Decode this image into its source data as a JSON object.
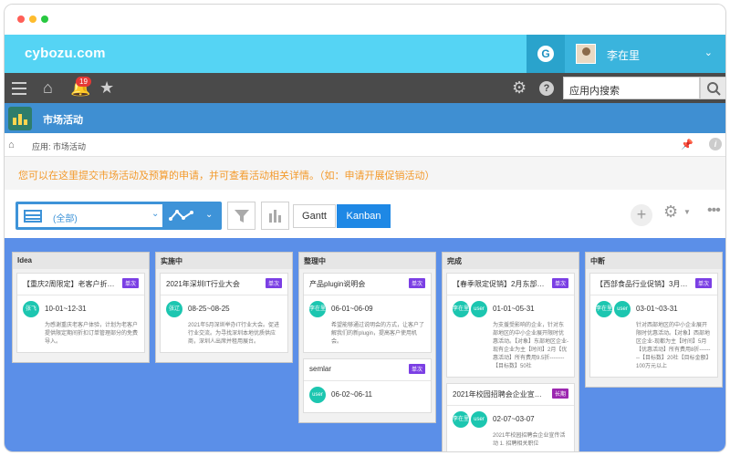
{
  "brand": "cybozu.com",
  "user": {
    "name": "李在里"
  },
  "notifications": {
    "count": "19"
  },
  "search": {
    "placeholder": "应用内搜索"
  },
  "app": {
    "title": "市场活动"
  },
  "breadcrumb": {
    "text": "应用: 市场活动"
  },
  "notice": "您可以在这里提交市场活动及预算的申请，并可查看活动相关详情。（如：申请开展促销活动）",
  "view": {
    "name": "(全部)"
  },
  "buttons": {
    "gantt": "Gantt",
    "kanban": "Kanban"
  },
  "colors": {
    "brand_bar": "#55d4f4",
    "toolbar": "#4a4a4a",
    "app_bar": "#3f8fd2",
    "board_bg": "#5b8fe8",
    "notice_text": "#f39a2c",
    "tag": "#7b3fe4",
    "avatar": "#1cc6b0"
  },
  "icons": [
    "grid-icon",
    "graph-icon",
    "filter-icon",
    "bar-chart-icon",
    "plus-icon",
    "gear-icon",
    "more-icon",
    "home-icon",
    "bell-icon",
    "star-icon",
    "search-icon",
    "pin-icon",
    "info-icon"
  ],
  "columns": [
    {
      "name": "Idea",
      "cards": [
        {
          "title": "【重庆2周限定】老客户折…",
          "tag": "单次",
          "date": "10-01~12-31",
          "avatars": [
            "张飞"
          ],
          "desc": "为感谢重庆老客户体验，计划为老客户提供限定期间折扣订单管理部分的免费导入。"
        }
      ]
    },
    {
      "name": "实施中",
      "cards": [
        {
          "title": "2021年深圳IT行业大会",
          "tag": "单次",
          "date": "08-25~08-25",
          "avatars": [
            "张辽"
          ],
          "desc": "2021年5月深圳举办IT行业大会。促进行业交流。为寻找深圳本地优质供应商，深圳人出席并租用展台。"
        }
      ]
    },
    {
      "name": "整理中",
      "cards": [
        {
          "title": "产品plugin说明会",
          "tag": "单次",
          "date": "06-01~06-09",
          "avatars": [
            "李在里"
          ],
          "desc": "希望能够通过说明会的方式，让客户了解我们的新plugin，提高客户使用机会。"
        },
        {
          "title": "semlar",
          "tag": "单次",
          "date": "06-02~06-11",
          "avatars": [
            "user"
          ],
          "desc": ""
        }
      ]
    },
    {
      "name": "完成",
      "cards": [
        {
          "title": "【春季限定促销】2月东部…",
          "tag": "单次",
          "date": "01-01~05-31",
          "avatars": [
            "李在里",
            "user"
          ],
          "desc": "为支援受影响的企业，针对东部地区的中小企业展开限时优惠活动。【对象】东部地区企业-现有企业为主【时间】2月【优惠活动】所有费用9.5折--------【目标数】50社"
        },
        {
          "title": "2021年校园招聘会企业宣…",
          "tag": "长期",
          "date": "02-07~03-07",
          "avatars": [
            "李在里",
            "user"
          ],
          "desc": "2021年校园招聘会企业宣传活动 1. 招聘相关职位"
        }
      ]
    },
    {
      "name": "中断",
      "cards": [
        {
          "title": "【西部食品行业促销】3月…",
          "tag": "单次",
          "date": "03-01~03-31",
          "avatars": [
            "李在里",
            "user"
          ],
          "desc": "针对西部地区的中小企业展开限时优惠活动。【对象】西部地区企业-现都为主【时间】5月【优惠活动】所有费用8折--------【目标数】20社【目标金额】100万元以上"
        }
      ]
    }
  ]
}
